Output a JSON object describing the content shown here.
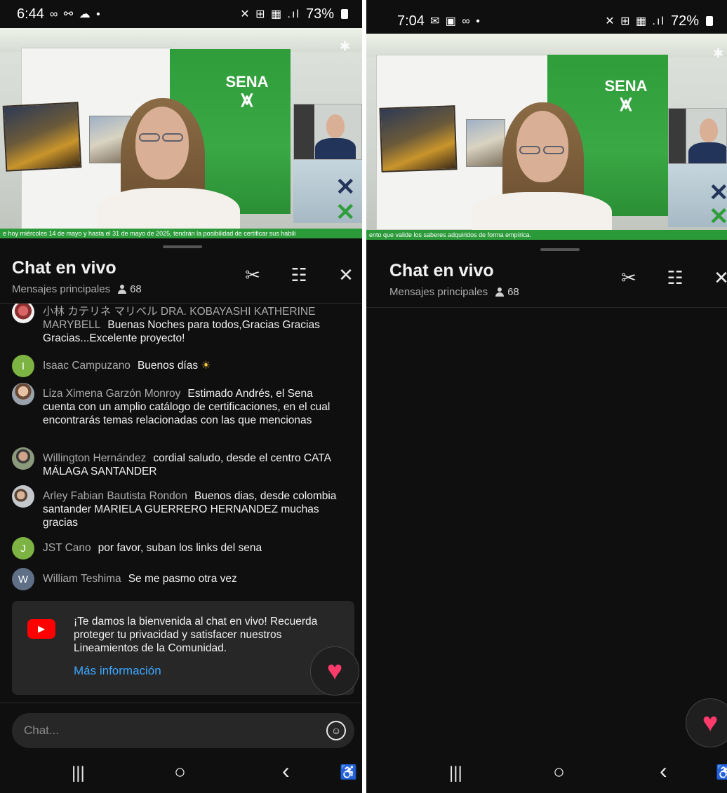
{
  "left": {
    "status": {
      "time": "6:44",
      "left_icons": "∞ ⚯ ☁ •",
      "right_icons": "✕ ⊞ ▦ .ıl",
      "battery": "73%"
    },
    "video": {
      "ticker": "e hoy miércoles 14 de mayo y hasta el 31 de mayo de 2025, tendrán la posibilidad de certificar sus habili",
      "logo_text": "SENA"
    },
    "chat": {
      "title": "Chat en vivo",
      "mode": "Mensajes principales",
      "viewer_count": "68",
      "messages": [
        {
          "author": "小林 カテリネ マリベル DRA. KOBAYASHI KATHERINE MARYBELL",
          "text": "Buenas Noches para todos,Gracias Gracias Gracias...Excelente proyecto!",
          "avatar": ""
        },
        {
          "author": "Isaac Campuzano",
          "text": "Buenos días",
          "emoji": "☀",
          "avatar": "I"
        },
        {
          "author": "Liza Ximena Garzón Monroy",
          "text": "Estimado Andrés, el Sena cuenta con un amplio catálogo de certificaciones, en el cual encontrarás temas relacionadas con las que mencionas",
          "avatar": ""
        },
        {
          "author": "Willington Hernández",
          "text": "cordial saludo, desde el centro CATA MÁLAGA SANTANDER",
          "avatar": ""
        },
        {
          "author": "Arley Fabian Bautista Rondon",
          "text": "Buenos dias, desde colombia santander MARIELA GUERRERO HERNANDEZ muchas gracias",
          "avatar": ""
        },
        {
          "author": "JST Cano",
          "text": "por favor, suban los links del sena",
          "avatar": "J"
        },
        {
          "author": "William Teshima",
          "text": "Se me pasmo otra vez",
          "avatar": "W"
        }
      ],
      "welcome": {
        "text": "¡Te damos la bienvenida al chat en vivo! Recuerda proteger tu privacidad y satisfacer nuestros Lineamientos de la Comunidad.",
        "link": "Más información"
      },
      "input_placeholder": "Chat..."
    }
  },
  "right": {
    "status": {
      "time": "7:04",
      "left_icons": "✉ ▣ ∞ •",
      "right_icons": "✕ ⊞ ▦ .ıl",
      "battery": "72%"
    },
    "video": {
      "ticker": "ento que valide los saberes adquiridos de forma empírica.",
      "logo_text": "SENA"
    },
    "chat": {
      "title": "Chat en vivo",
      "mode": "Mensajes principales",
      "viewer_count": "68"
    }
  },
  "icons": {
    "clip": "✂",
    "filter": "☷",
    "close": "✕",
    "heart": "♥",
    "emoji": "☺",
    "play": "▶",
    "nav_recents": "|||",
    "nav_home": "○",
    "nav_back": "‹",
    "nav_accessibility": "♿"
  },
  "colors": {
    "accent_green": "#39a845",
    "link_blue": "#3ea6ff",
    "heart_pink": "#ff3b6b",
    "youtube_red": "#ff0000"
  }
}
